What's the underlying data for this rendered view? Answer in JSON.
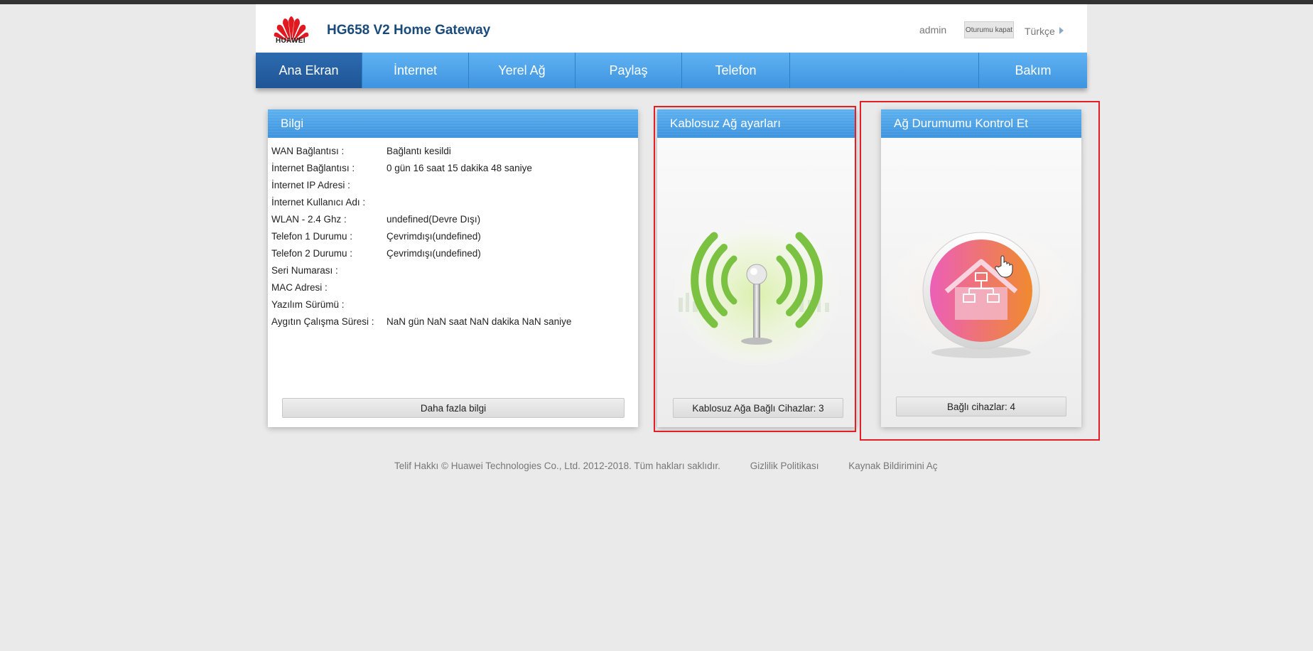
{
  "header": {
    "brand": "HUAWEI",
    "product_title": "HG658 V2 Home Gateway",
    "user": "admin",
    "logout_label": "Oturumu kapat",
    "language": "Türkçe"
  },
  "nav": {
    "items": [
      {
        "label": "Ana Ekran"
      },
      {
        "label": "İnternet"
      },
      {
        "label": "Yerel Ağ"
      },
      {
        "label": "Paylaş"
      },
      {
        "label": "Telefon"
      },
      {
        "label": "Bakım"
      }
    ]
  },
  "info_panel": {
    "title": "Bilgi",
    "rows": [
      {
        "label": "WAN Bağlantısı :",
        "value": "Bağlantı kesildi"
      },
      {
        "label": "İnternet Bağlantısı :",
        "value": "0 gün 16 saat 15 dakika 48 saniye"
      },
      {
        "label": "İnternet IP Adresi :",
        "value": ""
      },
      {
        "label": "İnternet Kullanıcı Adı :",
        "value": ""
      },
      {
        "label": "WLAN - 2.4 Ghz :",
        "value": "undefined(Devre Dışı)"
      },
      {
        "label": "Telefon 1 Durumu :",
        "value": "Çevrimdışı(undefined)"
      },
      {
        "label": "Telefon 2 Durumu :",
        "value": "Çevrimdışı(undefined)"
      },
      {
        "label": "Seri Numarası :",
        "value": ""
      },
      {
        "label": "MAC Adresi :",
        "value": ""
      },
      {
        "label": "Yazılım Sürümü :",
        "value": ""
      },
      {
        "label": "Aygıtın Çalışma Süresi :",
        "value": "NaN gün NaN saat NaN dakika NaN saniye"
      }
    ],
    "button_label": "Daha fazla bilgi"
  },
  "wifi_panel": {
    "title": "Kablosuz Ağ ayarları",
    "button_label": "Kablosuz Ağa Bağlı Cihazlar: 3"
  },
  "net_panel": {
    "title": "Ağ Durumumu Kontrol Et",
    "button_label": "Bağlı cihazlar: 4"
  },
  "footer": {
    "copyright": "Telif Hakkı © Huawei Technologies Co., Ltd. 2012-2018. Tüm hakları saklıdır.",
    "privacy": "Gizlilik Politikası",
    "open_source": "Kaynak Bildirimini Aç"
  },
  "colors": {
    "nav_blue": "#3d94e0",
    "nav_active": "#1f5596",
    "title_blue": "#1a4a7a",
    "highlight_red": "#e31e24"
  }
}
